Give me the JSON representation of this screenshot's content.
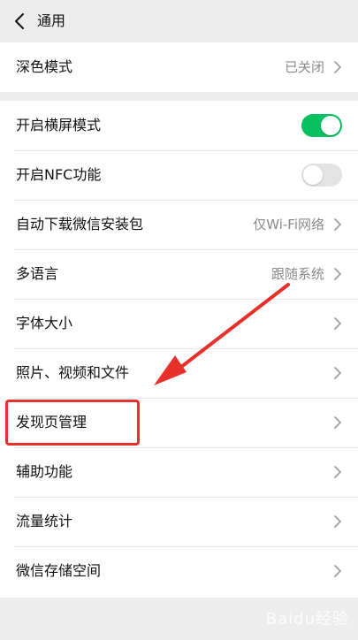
{
  "header": {
    "title": "通用"
  },
  "section1": {
    "rows": [
      {
        "label": "深色模式",
        "value": "已关闭"
      }
    ]
  },
  "section2": {
    "rows": [
      {
        "label": "开启横屏模式",
        "toggle": "on"
      },
      {
        "label": "开启NFC功能",
        "toggle": "off"
      },
      {
        "label": "自动下载微信安装包",
        "value": "仅Wi-Fi网络"
      },
      {
        "label": "多语言",
        "value": "跟随系统"
      },
      {
        "label": "字体大小"
      },
      {
        "label": "照片、视频和文件"
      },
      {
        "label": "发现页管理"
      },
      {
        "label": "辅助功能"
      },
      {
        "label": "流量统计"
      },
      {
        "label": "微信存储空间"
      }
    ]
  },
  "annotation": {
    "highlight_color": "#e8302a"
  },
  "colors": {
    "toggle_on": "#07c160",
    "toggle_off": "#e3e3e3"
  },
  "watermark": "Baidu经验"
}
